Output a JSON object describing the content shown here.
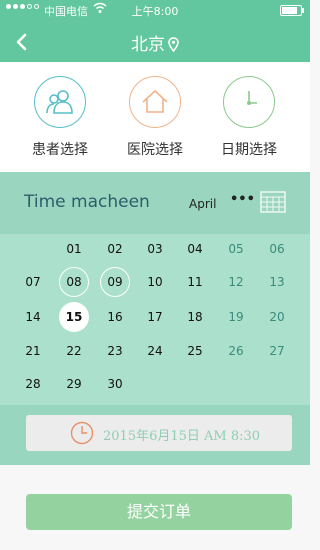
{
  "status_bar": {
    "carrier": "中国电信",
    "time": "上午8:00",
    "battery_level": 0.85
  },
  "nav": {
    "title": "北京"
  },
  "categories": [
    {
      "label": "患者选择",
      "icon": "patients-icon",
      "color": "#57bfc6"
    },
    {
      "label": "医院选择",
      "icon": "home-icon",
      "color": "#f0b48a"
    },
    {
      "label": "日期选择",
      "icon": "clock-icon",
      "color": "#8bc98b"
    }
  ],
  "calendar": {
    "title": "Time macheen",
    "month": "April",
    "more": "•••",
    "weeks": [
      [
        "",
        "01",
        "02",
        "03",
        "04",
        "05",
        "06"
      ],
      [
        "07",
        "08",
        "09",
        "10",
        "11",
        "12",
        "13"
      ],
      [
        "14",
        "15",
        "16",
        "17",
        "18",
        "19",
        "20"
      ],
      [
        "21",
        "22",
        "23",
        "24",
        "25",
        "26",
        "27"
      ],
      [
        "28",
        "29",
        "30",
        "",
        "",
        "",
        ""
      ]
    ],
    "selected": "15",
    "highlighted": [
      "08",
      "09"
    ]
  },
  "datetime": {
    "value": "2015年6月15日 AM 8:30"
  },
  "submit_label": "提交订单",
  "colors": {
    "primary": "#62c79e",
    "calendar_bg": "#abe0cc",
    "calendar_header": "#9ad6bf",
    "weekend": "#3a8c7a",
    "submit": "#94d3a0"
  }
}
